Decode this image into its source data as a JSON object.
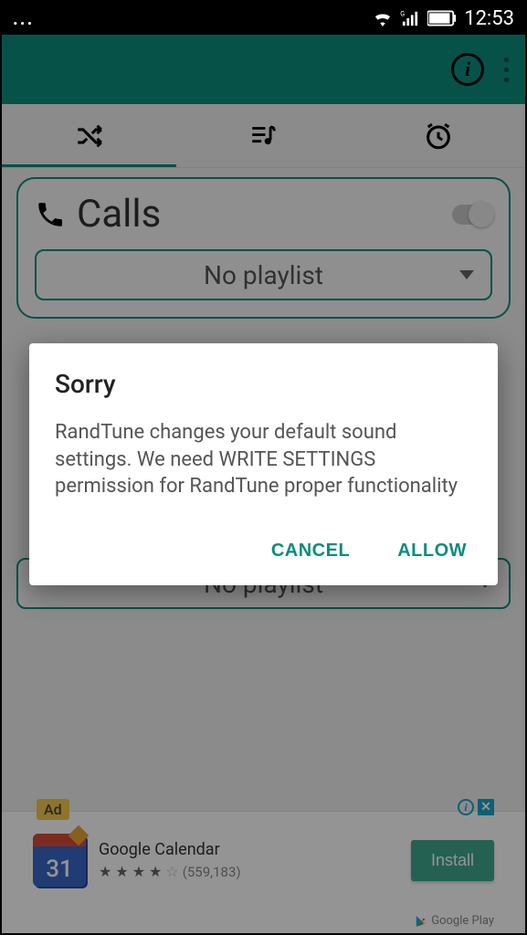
{
  "status": {
    "ellipsis": "...",
    "time": "12:53",
    "signal_sub": "G"
  },
  "appbar": {
    "info_letter": "i"
  },
  "tabs": {
    "shuffle": "shuffle",
    "playlist": "playlist",
    "alarm": "alarm"
  },
  "cards": {
    "calls": {
      "title": "Calls",
      "dropdown": "No playlist"
    }
  },
  "dropdown2": "No playlist",
  "dialog": {
    "title": "Sorry",
    "body": "RandTune changes your default sound settings. We need WRITE SETTINGS permission for RandTune proper functionality",
    "cancel": "CANCEL",
    "allow": "ALLOW"
  },
  "ad": {
    "badge": "Ad",
    "title": "Google Calendar",
    "rating_count": "(559,183)",
    "install": "Install",
    "calendar_day": "31",
    "play": "Google Play",
    "info_letter": "i",
    "close": "✕"
  }
}
